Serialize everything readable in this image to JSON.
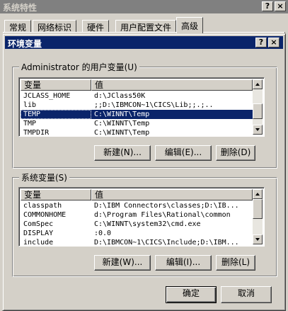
{
  "outer_window": {
    "title": "系统特性",
    "help_button": "?",
    "close_button": "×",
    "tabs": [
      "常规",
      "网络标识",
      "硬件",
      "用户配置文件",
      "高级"
    ]
  },
  "dialog": {
    "title": "环境变量",
    "help_button": "?",
    "close_button": "×",
    "user_group": {
      "label": "Administrator 的用户变量(U)",
      "columns": [
        "变量",
        "值"
      ],
      "rows": [
        {
          "name": "JCLASS_HOME",
          "value": "d:\\JClass50K"
        },
        {
          "name": "lib",
          "value": ";;D:\\IBMCON~1\\CICS\\Lib;;.;.."
        },
        {
          "name": "TEMP",
          "value": "C:\\WINNT\\Temp",
          "selected": true
        },
        {
          "name": "TMP",
          "value": "C:\\WINNT\\Temp"
        },
        {
          "name": "TMPDIR",
          "value": "C:\\WINNT\\Temp"
        }
      ],
      "buttons": {
        "new": "新建(N)...",
        "edit": "编辑(E)...",
        "delete": "删除(D)"
      }
    },
    "system_group": {
      "label": "系统变量(S)",
      "columns": [
        "变量",
        "值"
      ],
      "rows": [
        {
          "name": "classpath",
          "value": "D:\\IBM Connectors\\classes;D:\\IB..."
        },
        {
          "name": "COMMONHOME",
          "value": "d:\\Program Files\\Rational\\common"
        },
        {
          "name": "ComSpec",
          "value": "C:\\WINNT\\system32\\cmd.exe"
        },
        {
          "name": "DISPLAY",
          "value": ":0.0"
        },
        {
          "name": "include",
          "value": "D:\\IBMCON~1\\CICS\\Include;D:\\IBM..."
        }
      ],
      "buttons": {
        "new": "新建(W)...",
        "edit": "编辑(I)...",
        "delete": "删除(L)"
      }
    },
    "ok": "确定",
    "cancel": "取消"
  },
  "colors": {
    "face": "#d4d0c8",
    "active_title": "#0a246a",
    "inactive_title": "#808080",
    "selection": "#0a246a"
  }
}
